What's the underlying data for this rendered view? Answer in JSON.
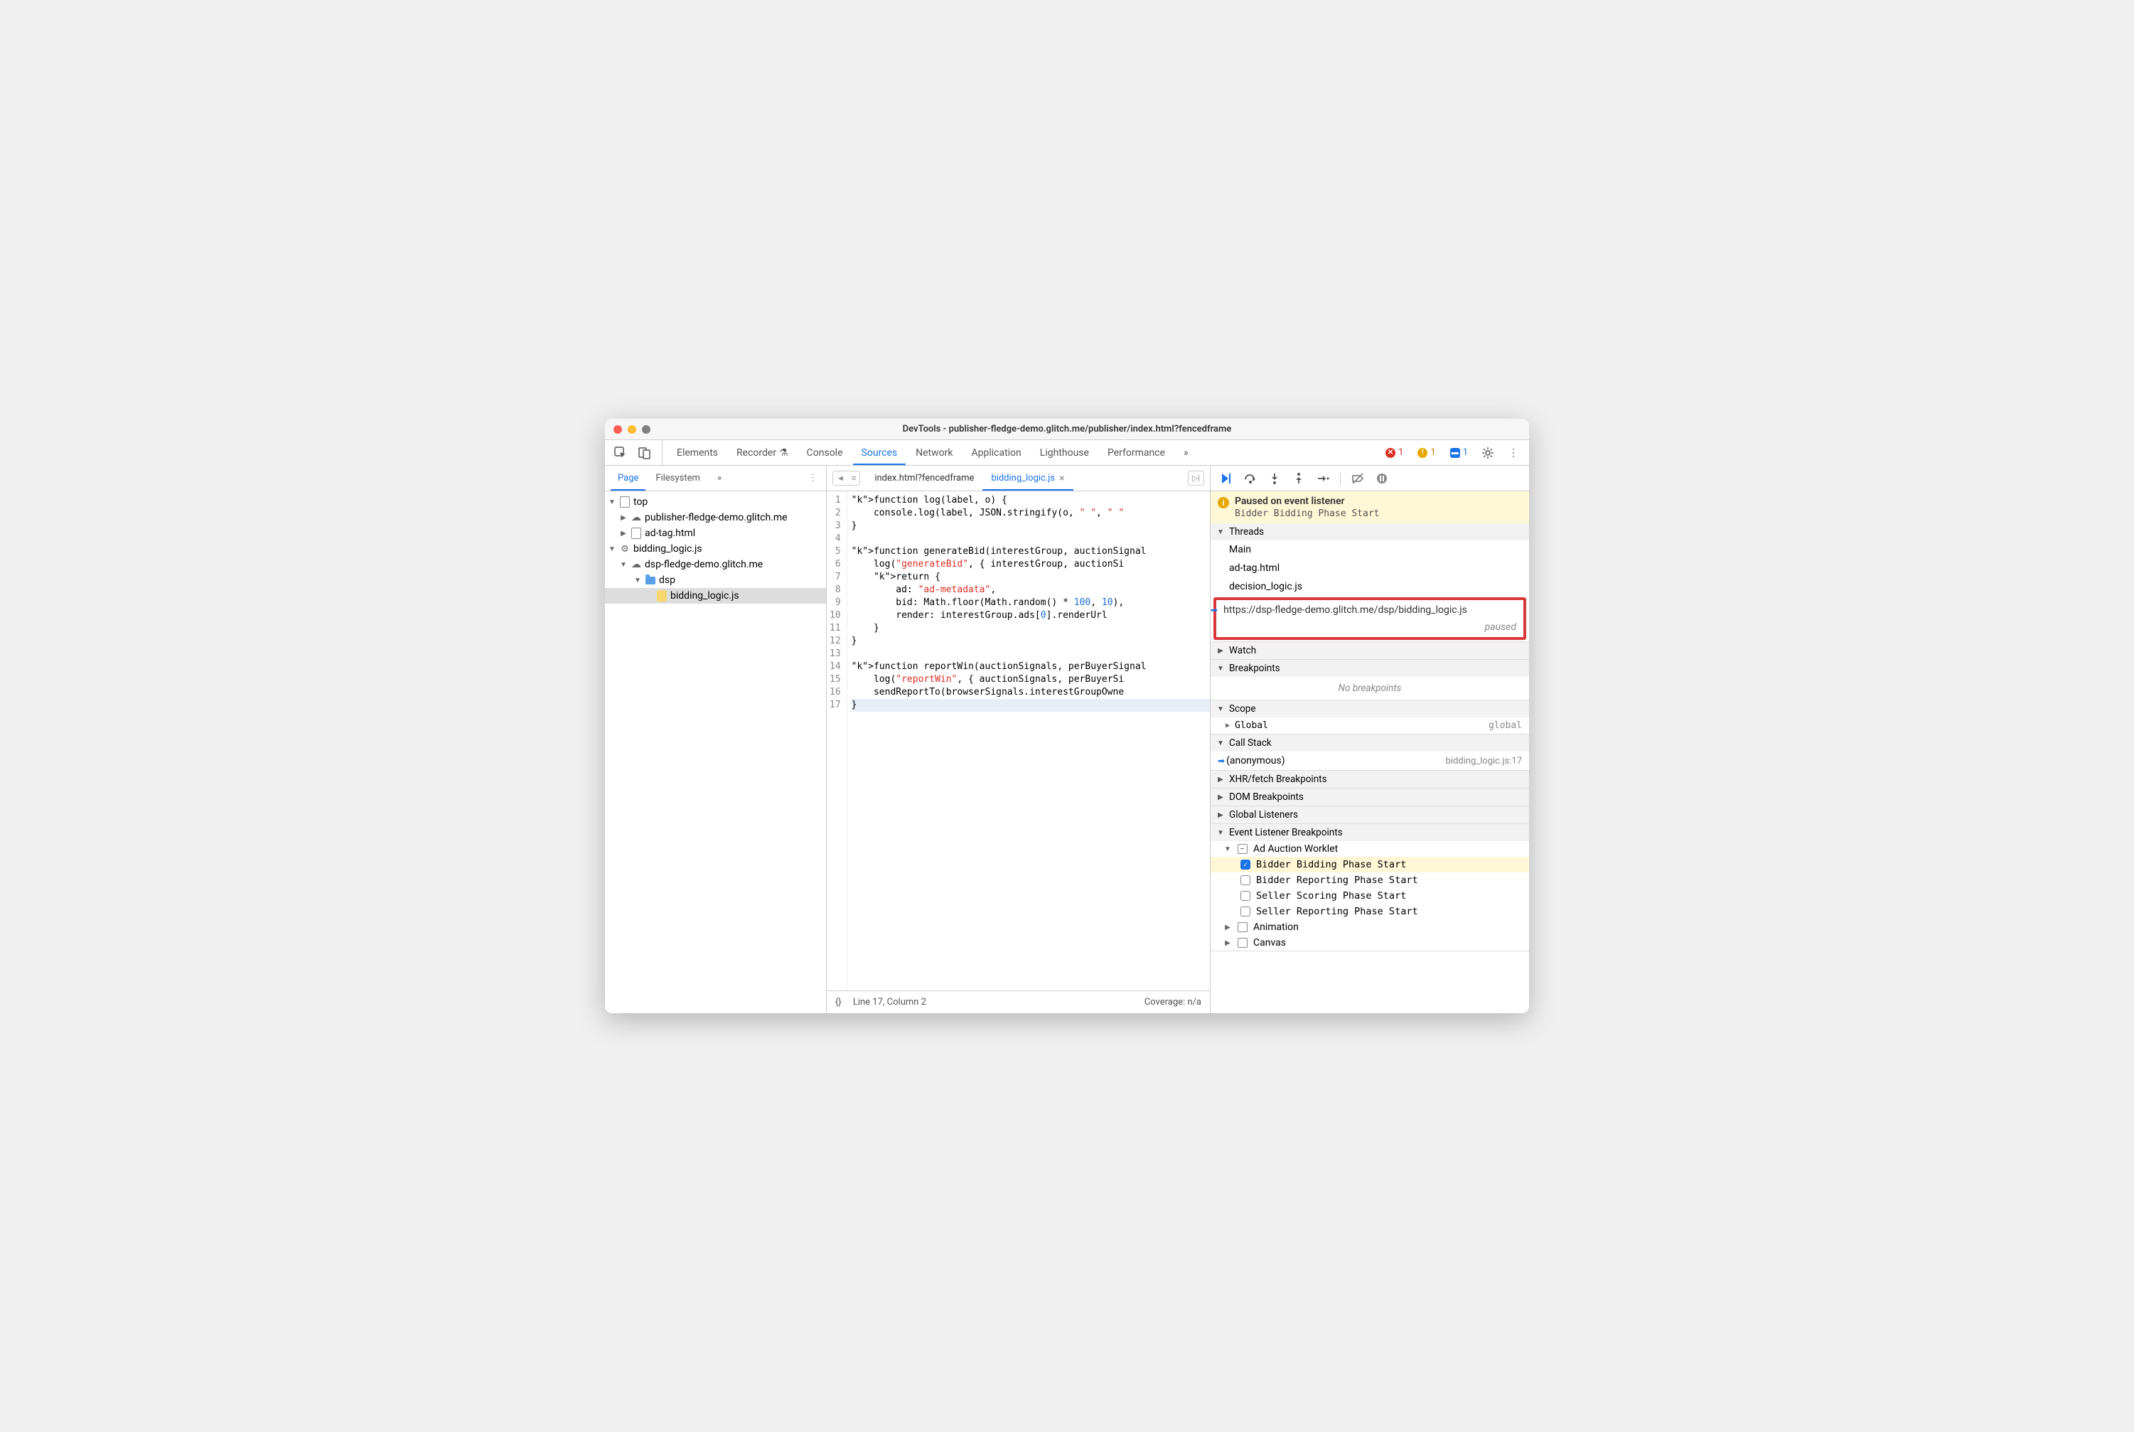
{
  "title": "DevTools - publisher-fledge-demo.glitch.me/publisher/index.html?fencedframe",
  "toolbar": {
    "tabs": [
      "Elements",
      "Recorder",
      "Console",
      "Sources",
      "Network",
      "Application",
      "Lighthouse",
      "Performance"
    ],
    "active_tab": "Sources",
    "errors": "1",
    "warnings": "1",
    "issues": "1"
  },
  "sidebar": {
    "tabs": [
      "Page",
      "Filesystem"
    ],
    "active": "Page",
    "tree": {
      "top": "top",
      "domain1": "publisher-fledge-demo.glitch.me",
      "adtag": "ad-tag.html",
      "bidding": "bidding_logic.js",
      "domain2": "dsp-fledge-demo.glitch.me",
      "dsp": "dsp",
      "biddingfile": "bidding_logic.js"
    }
  },
  "editor": {
    "tabs": [
      {
        "name": "index.html?fencedframe",
        "active": false
      },
      {
        "name": "bidding_logic.js",
        "active": true
      }
    ],
    "line_count": 17,
    "status_line": "Line 17, Column 2",
    "coverage": "Coverage: n/a",
    "format_btn": "{}"
  },
  "code": [
    "function log(label, o) {",
    "    console.log(label, JSON.stringify(o, \" \", \" \"",
    "}",
    "",
    "function generateBid(interestGroup, auctionSignal",
    "    log(\"generateBid\", { interestGroup, auctionSi",
    "    return {",
    "        ad: \"ad-metadata\",",
    "        bid: Math.floor(Math.random() * 100, 10),",
    "        render: interestGroup.ads[0].renderUrl",
    "    }",
    "}",
    "",
    "function reportWin(auctionSignals, perBuyerSignal",
    "    log(\"reportWin\", { auctionSignals, perBuyerSi",
    "    sendReportTo(browserSignals.interestGroupOwne",
    "}"
  ],
  "debug": {
    "pause_title": "Paused on event listener",
    "pause_sub": "Bidder Bidding Phase Start",
    "threads_label": "Threads",
    "threads": [
      {
        "name": "Main"
      },
      {
        "name": "ad-tag.html"
      },
      {
        "name": "decision_logic.js"
      },
      {
        "name": "https://dsp-fledge-demo.glitch.me/dsp/bidding_logic.js",
        "status": "paused",
        "active": true
      }
    ],
    "watch": "Watch",
    "breakpoints": "Breakpoints",
    "no_bp": "No breakpoints",
    "scope": "Scope",
    "global_label": "Global",
    "global_val": "global",
    "callstack": "Call Stack",
    "cs_name": "(anonymous)",
    "cs_src": "bidding_logic.js:17",
    "xhr": "XHR/fetch Breakpoints",
    "dom": "DOM Breakpoints",
    "gl": "Global Listeners",
    "elb": "Event Listener Breakpoints",
    "ad_auction": "Ad Auction Worklet",
    "events": [
      {
        "name": "Bidder Bidding Phase Start",
        "checked": true
      },
      {
        "name": "Bidder Reporting Phase Start",
        "checked": false
      },
      {
        "name": "Seller Scoring Phase Start",
        "checked": false
      },
      {
        "name": "Seller Reporting Phase Start",
        "checked": false
      }
    ],
    "animation": "Animation",
    "canvas": "Canvas"
  }
}
